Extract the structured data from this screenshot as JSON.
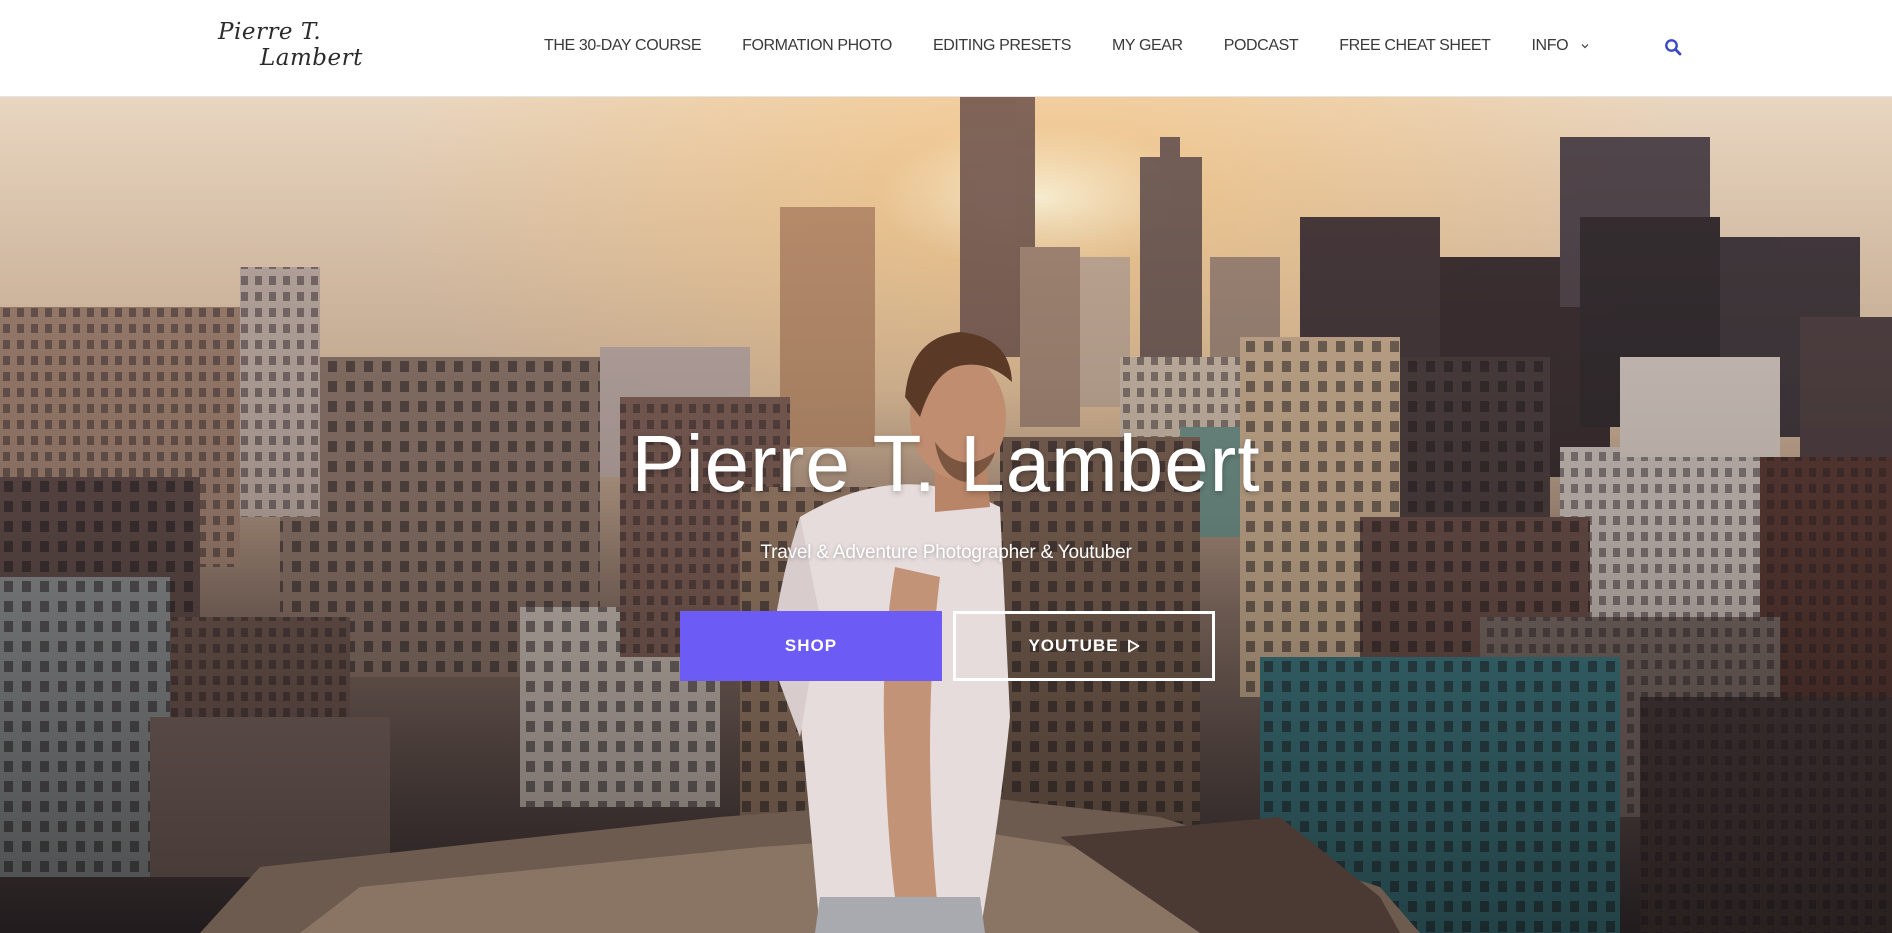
{
  "header": {
    "logo": {
      "line1": "Pierre T.",
      "line2": "Lambert"
    },
    "nav": [
      {
        "label": "THE 30-DAY COURSE"
      },
      {
        "label": "FORMATION PHOTO"
      },
      {
        "label": "EDITING PRESETS"
      },
      {
        "label": "MY GEAR"
      },
      {
        "label": "PODCAST"
      },
      {
        "label": "FREE CHEAT SHEET"
      },
      {
        "label": "INFO",
        "has_dropdown": true
      }
    ],
    "search_icon": "search-icon",
    "accent_color": "#3b48c4"
  },
  "hero": {
    "title": "Pierre T. Lambert",
    "subtitle": "Travel & Adventure Photographer & Youtuber",
    "buttons": {
      "shop": "SHOP",
      "youtube": "YOUTUBE"
    },
    "shop_color": "#6c5cf5"
  }
}
